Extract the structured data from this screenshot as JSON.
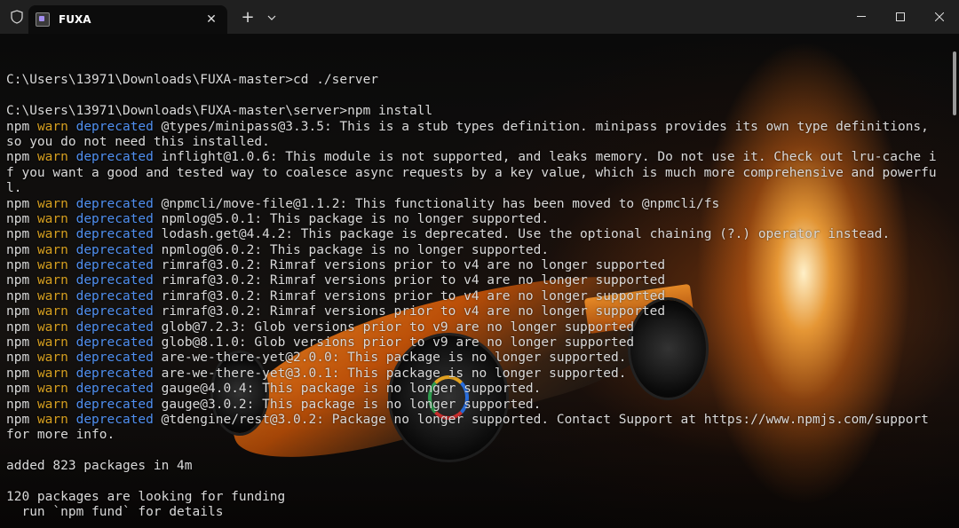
{
  "window": {
    "tab_title": "FUXA",
    "tab_close": "✕",
    "new_tab": "+",
    "dropdown": "⌄",
    "minimize": "—",
    "maximize": "☐",
    "close": "✕"
  },
  "colors": {
    "warn": "#d7a020",
    "deprecated": "#4f8ff0",
    "text": "#d9d9d9"
  },
  "terminal": {
    "lines": [
      {
        "type": "plain",
        "text": ""
      },
      {
        "type": "plain",
        "text": "C:\\Users\\13971\\Downloads\\FUXA-master>cd ./server"
      },
      {
        "type": "plain",
        "text": ""
      },
      {
        "type": "plain",
        "text": "C:\\Users\\13971\\Downloads\\FUXA-master\\server>npm install"
      },
      {
        "type": "warn",
        "npm": "npm",
        "warn": "warn",
        "dep": "deprecated",
        "msg": " @types/minipass@3.3.5: This is a stub types definition. minipass provides its own type definitions,"
      },
      {
        "type": "plain",
        "text": "so you do not need this installed."
      },
      {
        "type": "warn",
        "npm": "npm",
        "warn": "warn",
        "dep": "deprecated",
        "msg": " inflight@1.0.6: This module is not supported, and leaks memory. Do not use it. Check out lru-cache i"
      },
      {
        "type": "plain",
        "text": "f you want a good and tested way to coalesce async requests by a key value, which is much more comprehensive and powerfu"
      },
      {
        "type": "plain",
        "text": "l."
      },
      {
        "type": "warn",
        "npm": "npm",
        "warn": "warn",
        "dep": "deprecated",
        "msg": " @npmcli/move-file@1.1.2: This functionality has been moved to @npmcli/fs"
      },
      {
        "type": "warn",
        "npm": "npm",
        "warn": "warn",
        "dep": "deprecated",
        "msg": " npmlog@5.0.1: This package is no longer supported."
      },
      {
        "type": "warn",
        "npm": "npm",
        "warn": "warn",
        "dep": "deprecated",
        "msg": " lodash.get@4.4.2: This package is deprecated. Use the optional chaining (?.) operator instead."
      },
      {
        "type": "warn",
        "npm": "npm",
        "warn": "warn",
        "dep": "deprecated",
        "msg": " npmlog@6.0.2: This package is no longer supported."
      },
      {
        "type": "warn",
        "npm": "npm",
        "warn": "warn",
        "dep": "deprecated",
        "msg": " rimraf@3.0.2: Rimraf versions prior to v4 are no longer supported"
      },
      {
        "type": "warn",
        "npm": "npm",
        "warn": "warn",
        "dep": "deprecated",
        "msg": " rimraf@3.0.2: Rimraf versions prior to v4 are no longer supported"
      },
      {
        "type": "warn",
        "npm": "npm",
        "warn": "warn",
        "dep": "deprecated",
        "msg": " rimraf@3.0.2: Rimraf versions prior to v4 are no longer supported"
      },
      {
        "type": "warn",
        "npm": "npm",
        "warn": "warn",
        "dep": "deprecated",
        "msg": " rimraf@3.0.2: Rimraf versions prior to v4 are no longer supported"
      },
      {
        "type": "warn",
        "npm": "npm",
        "warn": "warn",
        "dep": "deprecated",
        "msg": " glob@7.2.3: Glob versions prior to v9 are no longer supported"
      },
      {
        "type": "warn",
        "npm": "npm",
        "warn": "warn",
        "dep": "deprecated",
        "msg": " glob@8.1.0: Glob versions prior to v9 are no longer supported"
      },
      {
        "type": "warn",
        "npm": "npm",
        "warn": "warn",
        "dep": "deprecated",
        "msg": " are-we-there-yet@2.0.0: This package is no longer supported."
      },
      {
        "type": "warn",
        "npm": "npm",
        "warn": "warn",
        "dep": "deprecated",
        "msg": " are-we-there-yet@3.0.1: This package is no longer supported."
      },
      {
        "type": "warn",
        "npm": "npm",
        "warn": "warn",
        "dep": "deprecated",
        "msg": " gauge@4.0.4: This package is no longer supported."
      },
      {
        "type": "warn",
        "npm": "npm",
        "warn": "warn",
        "dep": "deprecated",
        "msg": " gauge@3.0.2: This package is no longer supported."
      },
      {
        "type": "warn",
        "npm": "npm",
        "warn": "warn",
        "dep": "deprecated",
        "msg": " @tdengine/rest@3.0.2: Package no longer supported. Contact Support at https://www.npmjs.com/support"
      },
      {
        "type": "plain",
        "text": "for more info."
      },
      {
        "type": "plain",
        "text": ""
      },
      {
        "type": "plain",
        "text": "added 823 packages in 4m"
      },
      {
        "type": "plain",
        "text": ""
      },
      {
        "type": "plain",
        "text": "120 packages are looking for funding"
      },
      {
        "type": "plain",
        "text": "  run `npm fund` for details"
      }
    ]
  }
}
